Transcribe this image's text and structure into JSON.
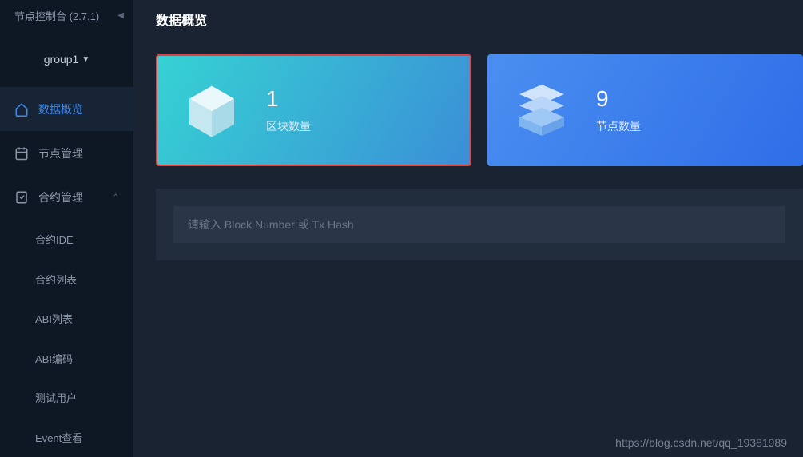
{
  "app": {
    "title": "节点控制台 (2.7.1)"
  },
  "group_selector": {
    "label": "group1"
  },
  "sidebar": {
    "items": [
      {
        "label": "数据概览",
        "active": true
      },
      {
        "label": "节点管理",
        "active": false
      },
      {
        "label": "合约管理",
        "active": false,
        "expanded": true
      }
    ],
    "subitems": [
      {
        "label": "合约IDE"
      },
      {
        "label": "合约列表"
      },
      {
        "label": "ABI列表"
      },
      {
        "label": "ABI编码"
      },
      {
        "label": "测试用户"
      },
      {
        "label": "Event查看"
      }
    ]
  },
  "page": {
    "title": "数据概览"
  },
  "cards": [
    {
      "value": "1",
      "label": "区块数量"
    },
    {
      "value": "9",
      "label": "节点数量"
    }
  ],
  "search": {
    "placeholder": "请输入 Block Number 或 Tx Hash"
  },
  "watermark": "https://blog.csdn.net/qq_19381989"
}
